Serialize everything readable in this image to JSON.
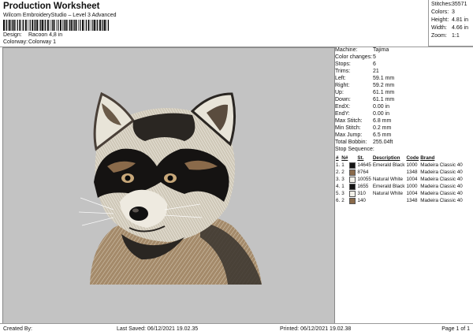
{
  "header": {
    "title": "Production Worksheet",
    "subtitle": "Wilcom EmbroideryStudio – Level 3 Advanced",
    "design_label": "Design:",
    "design_value": "Racoon 4,8 in",
    "colorway_label": "Colorway:",
    "colorway_value": "Colorway 1"
  },
  "stats": [
    {
      "label": "Stitches:",
      "value": "35571"
    },
    {
      "label": "Colors:",
      "value": "3"
    },
    {
      "label": "Height:",
      "value": "4.81 in"
    },
    {
      "label": "Width:",
      "value": "4.66 in"
    },
    {
      "label": "Zoom:",
      "value": "1:1"
    }
  ],
  "machine_info": [
    {
      "label": "Machine:",
      "value": "Tajima"
    },
    {
      "label": "Color changes:",
      "value": "5"
    },
    {
      "label": "Stops:",
      "value": "6"
    },
    {
      "label": "Trims:",
      "value": "21"
    },
    {
      "label": "Left:",
      "value": "59.1 mm"
    },
    {
      "label": "Right:",
      "value": "59.2 mm"
    },
    {
      "label": "Up:",
      "value": "61.1 mm"
    },
    {
      "label": "Down:",
      "value": "61.1 mm"
    },
    {
      "label": "EndX:",
      "value": "0.00 in"
    },
    {
      "label": "EndY:",
      "value": "0.00 in"
    },
    {
      "label": "Max Stitch:",
      "value": "6.8 mm"
    },
    {
      "label": "Min Stitch:",
      "value": "0.2 mm"
    },
    {
      "label": "Max Jump:",
      "value": "6.5 mm"
    },
    {
      "label": "Total Bobbin:",
      "value": "255.04ft"
    }
  ],
  "stop_sequence": {
    "title": "Stop Sequence:",
    "headers": [
      "#",
      "N#",
      "St.",
      "Description",
      "Code",
      "Brand"
    ],
    "rows": [
      {
        "num": "1.",
        "n": "1",
        "color": "#141414",
        "st": "14645",
        "desc": "Emerald Black",
        "code": "1000",
        "brand": "Madeira Classic 40"
      },
      {
        "num": "2.",
        "n": "2",
        "color": "#8a6a4a",
        "st": "8764",
        "desc": "",
        "code": "1348",
        "brand": "Madeira Classic 40"
      },
      {
        "num": "3.",
        "n": "3",
        "color": "#f2f0e8",
        "st": "10055",
        "desc": "Natural White",
        "code": "1004",
        "brand": "Madeira Classic 40"
      },
      {
        "num": "4.",
        "n": "1",
        "color": "#141414",
        "st": "1655",
        "desc": "Emerald Black",
        "code": "1000",
        "brand": "Madeira Classic 40"
      },
      {
        "num": "5.",
        "n": "3",
        "color": "#f2f0e8",
        "st": "310",
        "desc": "Natural White",
        "code": "1004",
        "brand": "Madeira Classic 40"
      },
      {
        "num": "6.",
        "n": "2",
        "color": "#8a6a4a",
        "st": "140",
        "desc": "",
        "code": "1348",
        "brand": "Madeira Classic 40"
      }
    ]
  },
  "footer": {
    "created_by": "Created By:",
    "last_saved": "Last Saved: 06/12/2021 19.02.35",
    "printed": "Printed: 06/12/2021 19.02.38",
    "page": "Page 1 of 1"
  }
}
